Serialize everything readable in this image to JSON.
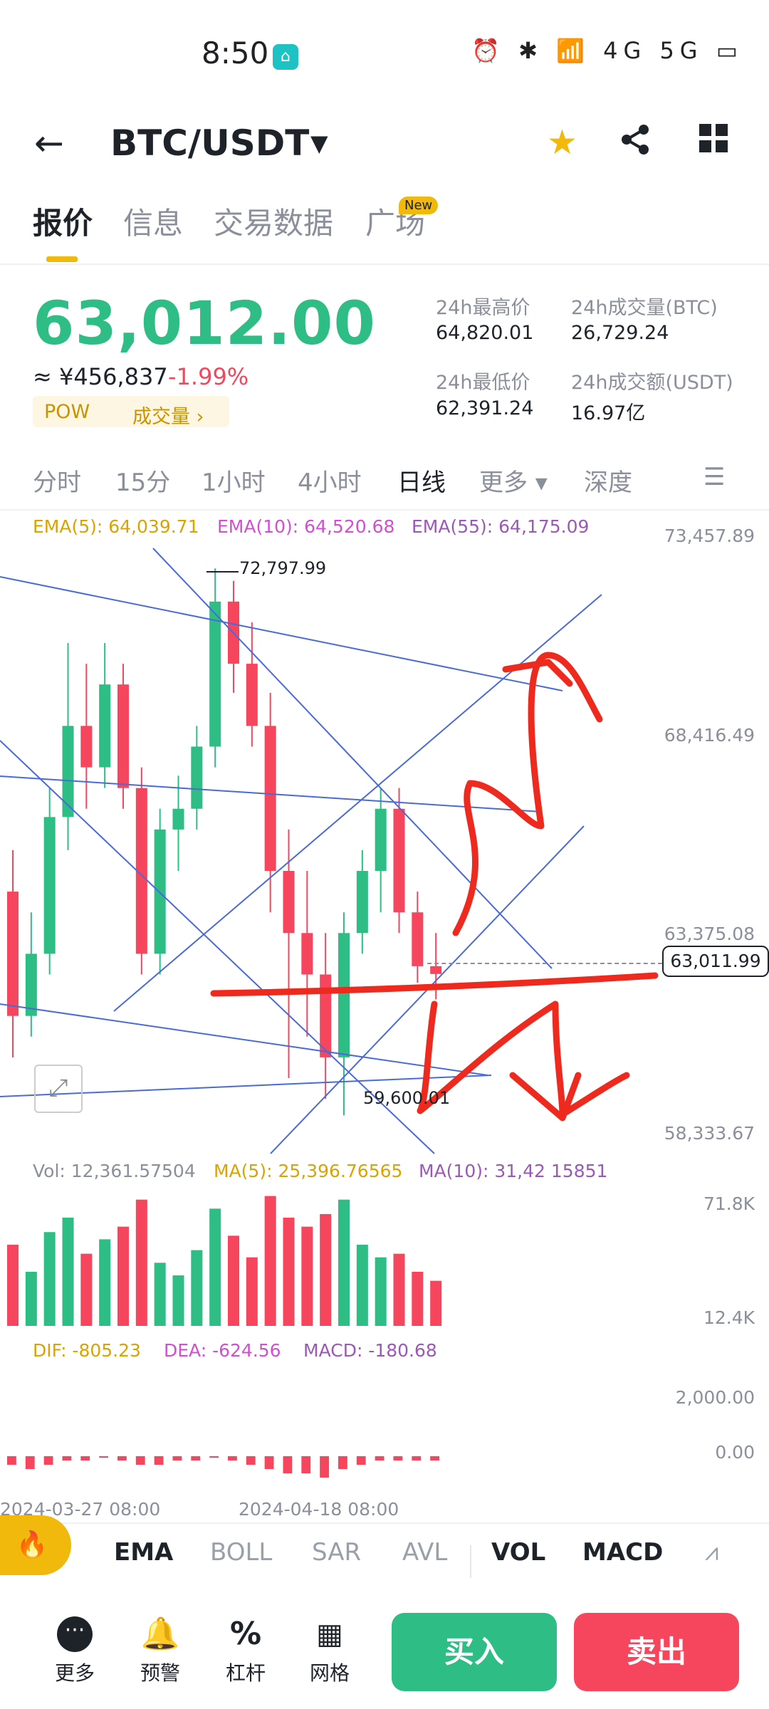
{
  "status_bar": {
    "time": "8:50",
    "icons": "⏰ ✱ 📶 4G 5G ▭"
  },
  "header": {
    "title": "BTC/USDT"
  },
  "tabs": [
    {
      "label": "报价"
    },
    {
      "label": "信息"
    },
    {
      "label": "交易数据"
    },
    {
      "label": "广场"
    }
  ],
  "new_badge": "New",
  "ticker": {
    "price": "63,012.00",
    "cny": "≈ ¥456,837",
    "change": "-1.99%",
    "pow": "POW",
    "volume_link": "成交量 ›",
    "high_label": "24h最高价",
    "high": "64,820.01",
    "vol_btc_label": "24h成交量(BTC)",
    "vol_btc": "26,729.24",
    "low_label": "24h最低价",
    "low": "62,391.24",
    "vol_usdt_label": "24h成交额(USDT)",
    "vol_usdt": "16.97亿"
  },
  "intervals": [
    "分时",
    "15分",
    "1小时",
    "4小时",
    "日线",
    "更多 ▾",
    "深度"
  ],
  "ema": {
    "e5": "EMA(5): 64,039.71",
    "e10": "EMA(10): 64,520.68",
    "e55": "EMA(55): 64,175.09"
  },
  "price_axis": [
    "73,457.89",
    "68,416.49",
    "63,375.08",
    "58,333.67"
  ],
  "current_price_tag": "63,011.99",
  "annotations": {
    "high": "72,797.99",
    "low": "59,600.01"
  },
  "vol_row": {
    "vol": "Vol: 12,361.57504",
    "ma5": "MA(5): 25,396.76565",
    "ma10": "MA(10): 31,42 15851"
  },
  "vol_axis": [
    "71.8K",
    "12.4K"
  ],
  "macd_row": {
    "dif": "DIF: -805.23",
    "dea": "DEA: -624.56",
    "macd": "MACD: -180.68"
  },
  "macd_axis": [
    "2,000.00",
    "0.00"
  ],
  "dates": [
    "2024-03-27 08:00",
    "2024-04-18 08:00"
  ],
  "indicator_tabs": [
    "EMA",
    "BOLL",
    "SAR",
    "AVL",
    "VOL",
    "MACD"
  ],
  "bottom": {
    "more": "更多",
    "alert": "预警",
    "leverage": "杠杆",
    "grid": "网格",
    "buy": "买入",
    "sell": "卖出"
  },
  "colors": {
    "up": "#2ebd85",
    "down": "#f6465d",
    "accent": "#f0b90b"
  },
  "chart_data": {
    "type": "candlestick",
    "price_range": [
      58333.67,
      73457.89
    ],
    "candles": [
      [
        65000,
        62000,
        66000,
        61000
      ],
      [
        62000,
        63500,
        64500,
        61500
      ],
      [
        63500,
        66800,
        67500,
        63000
      ],
      [
        66800,
        69000,
        71000,
        66000
      ],
      [
        69000,
        68000,
        70500,
        67000
      ],
      [
        68000,
        70000,
        71000,
        67500
      ],
      [
        70000,
        67500,
        70500,
        67000
      ],
      [
        67500,
        63500,
        68000,
        63000
      ],
      [
        63500,
        66500,
        67000,
        63000
      ],
      [
        66500,
        67000,
        67800,
        65500
      ],
      [
        67000,
        68500,
        69000,
        66500
      ],
      [
        68500,
        72000,
        72800,
        68000
      ],
      [
        72000,
        70500,
        72500,
        69800
      ],
      [
        70500,
        69000,
        71500,
        68500
      ],
      [
        69000,
        65500,
        69800,
        64500
      ],
      [
        65500,
        64000,
        66500,
        60500
      ],
      [
        64000,
        63000,
        65500,
        61500
      ],
      [
        63000,
        61000,
        64000,
        60000
      ],
      [
        61000,
        64000,
        64500,
        59600
      ],
      [
        64000,
        65500,
        66000,
        63500
      ],
      [
        65500,
        67000,
        67500,
        64500
      ],
      [
        67000,
        64500,
        67500,
        64000
      ],
      [
        64500,
        63200,
        65000,
        62800
      ],
      [
        63200,
        63012,
        64000,
        62400
      ]
    ],
    "volume": [
      45,
      30,
      52,
      60,
      40,
      48,
      55,
      70,
      35,
      28,
      42,
      65,
      50,
      38,
      72,
      60,
      55,
      62,
      70,
      45,
      38,
      40,
      30,
      25
    ],
    "macd": [
      -2,
      -3,
      -2,
      -1,
      -1,
      0,
      -1,
      -2,
      -2,
      -1,
      -1,
      0,
      -1,
      -2,
      -3,
      -4,
      -4,
      -5,
      -3,
      -2,
      -1,
      -1,
      -1,
      -1
    ]
  }
}
